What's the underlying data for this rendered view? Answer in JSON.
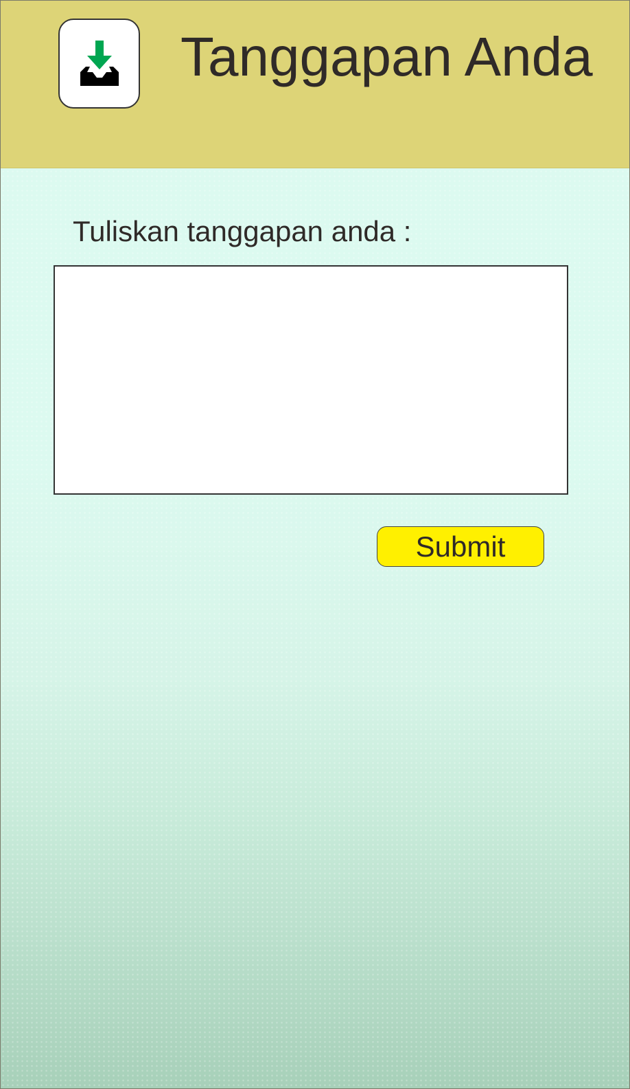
{
  "header": {
    "title": "Tanggapan Anda",
    "icon": "inbox-download-icon",
    "background_color": "#ddd477"
  },
  "form": {
    "prompt_label": "Tuliskan tanggapan anda :",
    "response_value": "",
    "submit_label": "Submit",
    "submit_color": "#fff000"
  },
  "colors": {
    "page_background": "#dcfaf0",
    "accent_green": "#00a651",
    "text": "#2f2a28"
  }
}
